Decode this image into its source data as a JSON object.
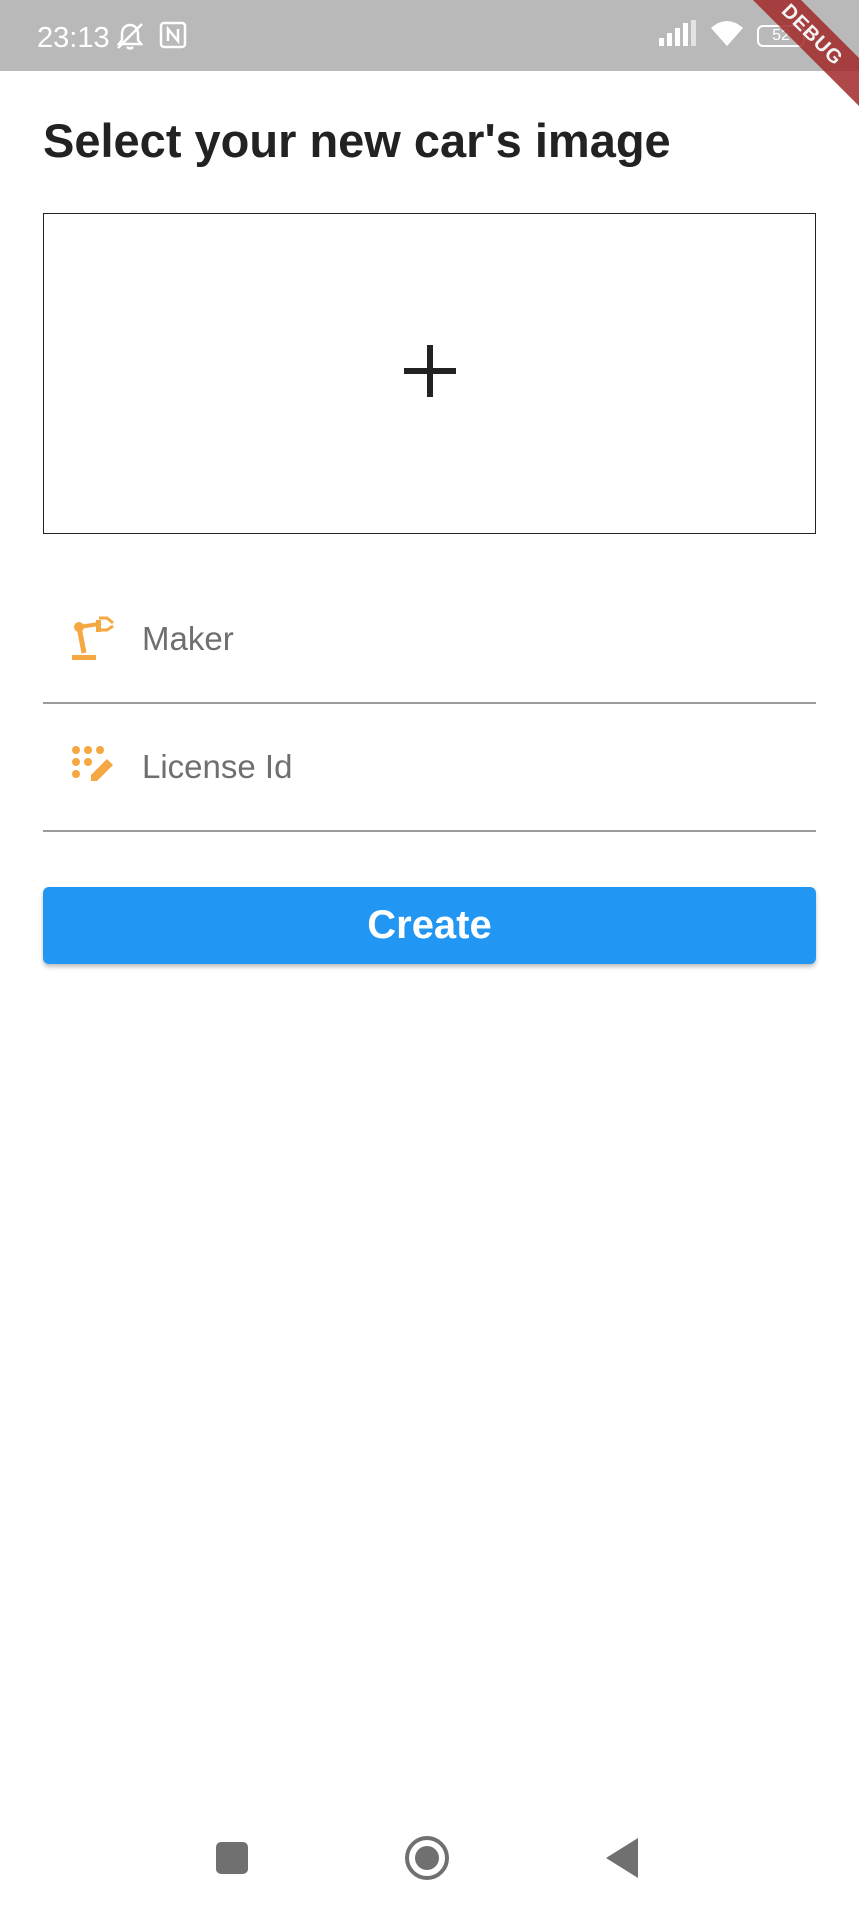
{
  "status_bar": {
    "time": "23:13",
    "battery": "52",
    "left_icons": [
      "silent-mode-icon",
      "nfc-icon"
    ],
    "right_icons": [
      "signal-icon",
      "wifi-icon",
      "battery-icon"
    ]
  },
  "debug_banner": "DEBUG",
  "page": {
    "title": "Select your new car's image",
    "image_picker_icon": "add-icon"
  },
  "form": {
    "maker": {
      "icon": "precision-manufacturing-icon",
      "placeholder": "Maker",
      "value": ""
    },
    "license": {
      "icon": "pin-edit-icon",
      "placeholder": "License Id",
      "value": ""
    },
    "create_label": "Create"
  },
  "nav_bar": {
    "items": [
      "recents-icon",
      "home-icon",
      "back-icon"
    ]
  },
  "colors": {
    "status_bar": "#b9b9b9",
    "accent": "#2196f3",
    "icon": "#f5a742",
    "title": "#222222",
    "debug": "#a22a2a"
  }
}
